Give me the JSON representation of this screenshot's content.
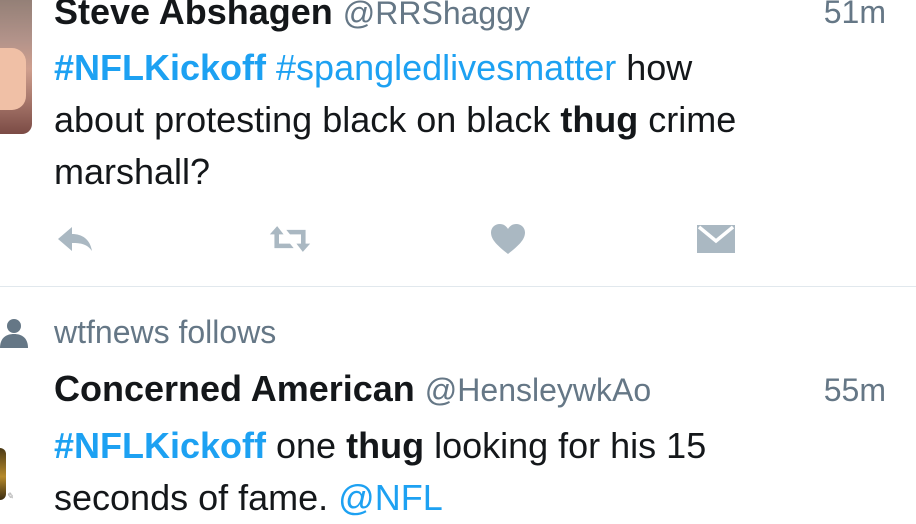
{
  "tweets": [
    {
      "name": "Steve Abshagen",
      "handle": "@RRShaggy",
      "time": "51m",
      "line1": {
        "h1": "#NFLKickoff",
        "sp1": " ",
        "h2": "#spangledlivesmatter",
        "rest": " how"
      },
      "line2": {
        "pre": "about protesting black on black ",
        "bold": "thug",
        "post": " crime"
      },
      "line3": "marshall?"
    },
    {
      "context": "wtfnews follows",
      "name": "Concerned American",
      "handle": "@HensleywkAo",
      "time": "55m",
      "line1": {
        "h1": "#NFLKickoff",
        "pre": " one ",
        "bold": "thug",
        "post": " looking for his 15"
      },
      "line2": {
        "pre": "seconds of fame. ",
        "mention": "@NFL"
      }
    }
  ],
  "icons": {
    "reply": "reply-icon",
    "retweet": "retweet-icon",
    "like": "heart-icon",
    "message": "envelope-icon",
    "follows": "person-icon"
  },
  "colors": {
    "link": "#1da1f2",
    "secondary": "#657786",
    "icon": "#aab8c2",
    "text": "#14171a",
    "divider": "#e1e8ed"
  }
}
